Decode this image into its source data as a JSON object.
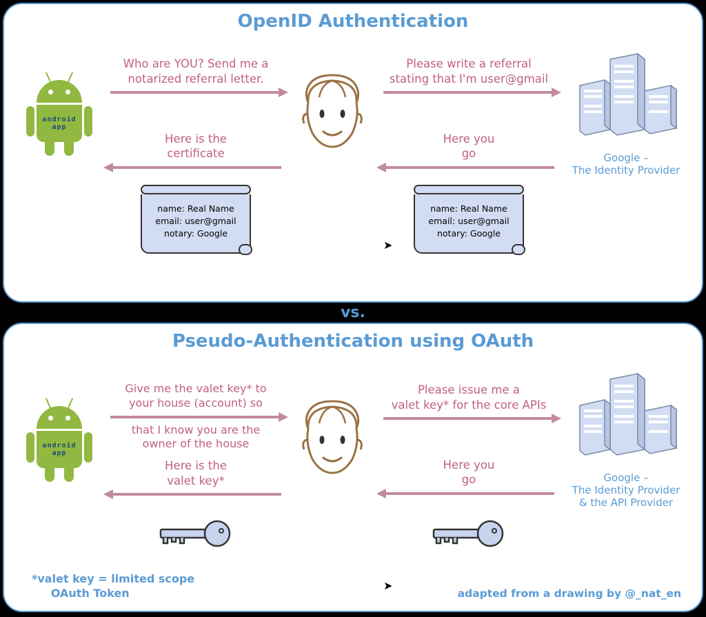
{
  "vs_label": "vs.",
  "android_label_line1": "android",
  "android_label_line2": "app",
  "panels": {
    "openid": {
      "title": "OpenID Authentication",
      "provider_line1": "Google –",
      "provider_line2": "The Identity Provider",
      "msg_app_to_user_line1": "Who are YOU? Send me a",
      "msg_app_to_user_line2": "notarized referral letter.",
      "msg_user_to_provider_line1": "Please write a referral",
      "msg_user_to_provider_line2": "stating that I'm user@gmail",
      "msg_user_to_app_line1": "Here is the",
      "msg_user_to_app_line2": "certificate",
      "msg_provider_to_user_line1": "Here you",
      "msg_provider_to_user_line2": "go",
      "cert_line1": "name: Real Name",
      "cert_line2": "email: user@gmail",
      "cert_line3": "notary: Google"
    },
    "oauth": {
      "title": "Pseudo-Authentication using OAuth",
      "provider_line1": "Google –",
      "provider_line2": "The Identity Provider",
      "provider_line3": "& the API Provider",
      "msg_app_to_user_line1": "Give me the valet key* to",
      "msg_app_to_user_line2": "your house (account) so",
      "msg_app_to_user_line3": "that I know you are the",
      "msg_app_to_user_line4": "owner of the house",
      "msg_user_to_provider_line1": "Please issue me a",
      "msg_user_to_provider_line2": "valet key* for the core APIs",
      "msg_user_to_app_line1": "Here is the",
      "msg_user_to_app_line2": "valet key*",
      "msg_provider_to_user_line1": "Here you",
      "msg_provider_to_user_line2": "go",
      "footnote_line1": "*valet key = limited scope",
      "footnote_line2": "OAuth Token",
      "attribution": "adapted from a drawing by @_nat_en"
    }
  }
}
